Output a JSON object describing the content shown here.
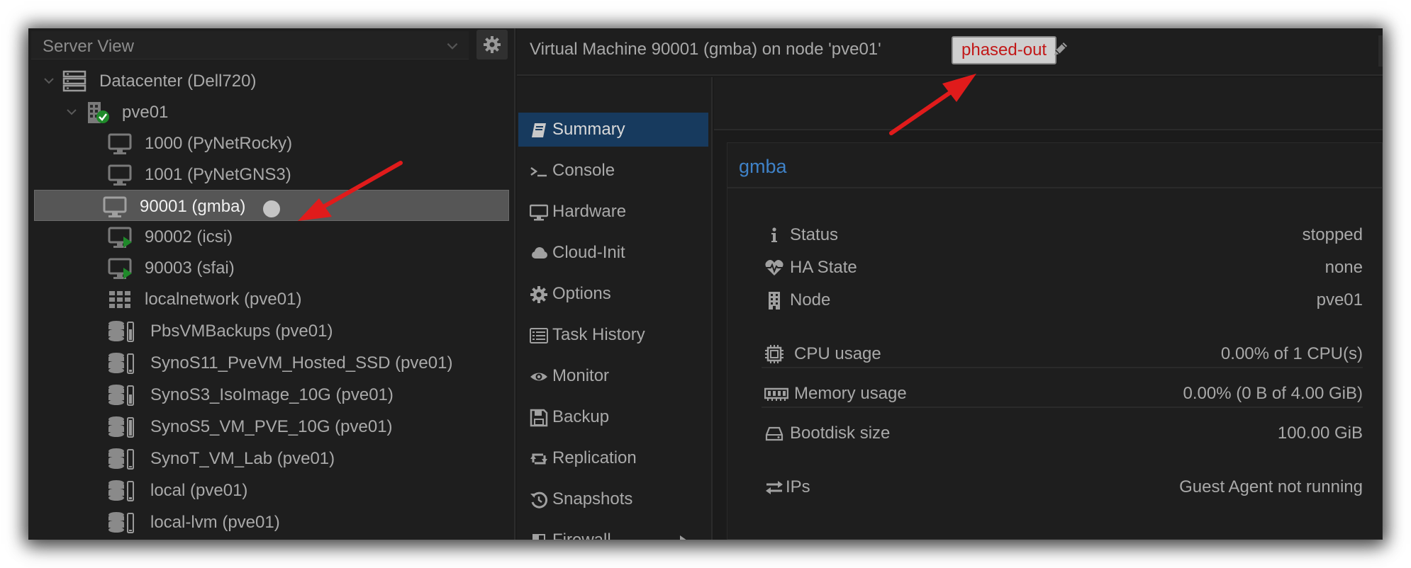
{
  "tree": {
    "view_label": "Server View",
    "items": [
      {
        "label": "Datacenter (Dell720)",
        "icon": "datacenter-icon"
      },
      {
        "label": "pve01",
        "icon": "node-online-icon"
      },
      {
        "label": "1000 (PyNetRocky)",
        "icon": "vm-stopped-icon"
      },
      {
        "label": "1001 (PyNetGNS3)",
        "icon": "vm-stopped-icon"
      },
      {
        "label": "90001 (gmba)",
        "icon": "vm-stopped-icon"
      },
      {
        "label": "90002 (icsi)",
        "icon": "vm-running-icon"
      },
      {
        "label": "90003 (sfai)",
        "icon": "vm-running-icon"
      },
      {
        "label": "localnetwork (pve01)",
        "icon": "sdn-grid-icon"
      },
      {
        "label": "PbsVMBackups (pve01)",
        "icon": "storage-icon"
      },
      {
        "label": "SynoS11_PveVM_Hosted_SSD (pve01)",
        "icon": "storage-icon"
      },
      {
        "label": "SynoS3_IsoImage_10G (pve01)",
        "icon": "storage-icon"
      },
      {
        "label": "SynoS5_VM_PVE_10G (pve01)",
        "icon": "storage-icon"
      },
      {
        "label": "SynoT_VM_Lab (pve01)",
        "icon": "storage-icon"
      },
      {
        "label": "local (pve01)",
        "icon": "storage-icon"
      },
      {
        "label": "local-lvm (pve01)",
        "icon": "storage-icon"
      }
    ]
  },
  "header": {
    "title": "Virtual Machine 90001 (gmba) on node 'pve01'",
    "tag": "phased-out"
  },
  "nav": {
    "items": [
      {
        "label": "Summary",
        "icon": "book-icon",
        "active": true
      },
      {
        "label": "Console",
        "icon": "terminal-icon"
      },
      {
        "label": "Hardware",
        "icon": "monitor-icon"
      },
      {
        "label": "Cloud-Init",
        "icon": "cloud-icon"
      },
      {
        "label": "Options",
        "icon": "gear-icon"
      },
      {
        "label": "Task History",
        "icon": "list-icon"
      },
      {
        "label": "Monitor",
        "icon": "eye-icon"
      },
      {
        "label": "Backup",
        "icon": "floppy-icon"
      },
      {
        "label": "Replication",
        "icon": "retweet-icon"
      },
      {
        "label": "Snapshots",
        "icon": "history-icon"
      },
      {
        "label": "Firewall",
        "icon": "shield-icon"
      }
    ]
  },
  "summary": {
    "title": "gmba",
    "rows": [
      {
        "label": "Status",
        "value": "stopped",
        "icon": "info-icon"
      },
      {
        "label": "HA State",
        "value": "none",
        "icon": "heartbeat-icon"
      },
      {
        "label": "Node",
        "value": "pve01",
        "icon": "building-icon"
      },
      {
        "label": "CPU usage",
        "value": "0.00% of 1 CPU(s)",
        "icon": "cpu-icon"
      },
      {
        "label": "Memory usage",
        "value": "0.00% (0 B of 4.00 GiB)",
        "icon": "memory-icon"
      },
      {
        "label": "Bootdisk size",
        "value": "100.00 GiB",
        "icon": "hdd-icon"
      },
      {
        "label": "IPs",
        "value": "Guest Agent not running",
        "icon": "exchange-icon"
      }
    ]
  },
  "colors": {
    "accent": "#173a5e",
    "title_blue": "#3f82c8",
    "tag_text": "#c21818",
    "running_green": "#1f8a2a",
    "annotation_red": "#e01b1b"
  }
}
